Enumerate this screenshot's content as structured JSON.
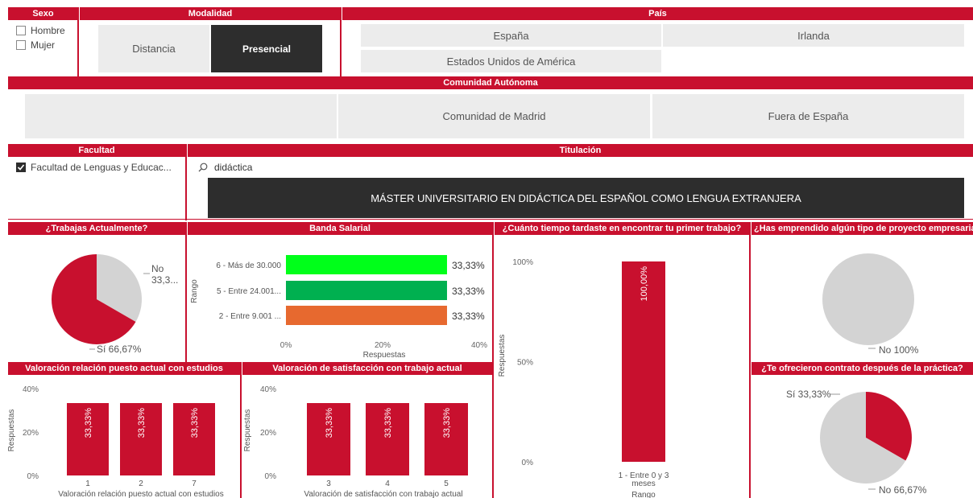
{
  "filters": {
    "sexo": {
      "header": "Sexo",
      "options": [
        "Hombre",
        "Mujer"
      ]
    },
    "modalidad": {
      "header": "Modalidad",
      "options": [
        "Distancia",
        "Presencial"
      ],
      "selected": "Presencial"
    },
    "pais": {
      "header": "País",
      "options": [
        "España",
        "Irlanda",
        "Estados Unidos de América"
      ]
    },
    "comunidad": {
      "header": "Comunidad Autónoma",
      "options": [
        "",
        "Comunidad de Madrid",
        "Fuera de España"
      ]
    },
    "facultad": {
      "header": "Facultad",
      "option": "Facultad de Lenguas y Educac..."
    },
    "titulacion": {
      "header": "Titulación",
      "search_value": "didáctica",
      "result": "MÁSTER UNIVERSITARIO EN DIDÁCTICA DEL ESPAÑOL COMO LENGUA EXTRANJERA"
    }
  },
  "colors": {
    "brand": "#c8102e",
    "grey": "#d3d3d3",
    "dark": "#2d2d2d",
    "green_bright": "#00ff1a",
    "green": "#00b050",
    "orange": "#e7692f"
  },
  "charts": {
    "trabajas": {
      "title": "¿Trabajas Actualmente?",
      "label_no": "No",
      "label_no_pct": "33,3...",
      "label_si": "Sí 66,67%"
    },
    "banda": {
      "title": "Banda Salarial",
      "ylabel": "Rango",
      "xlabel": "Respuestas"
    },
    "tiempo": {
      "title": "¿Cuánto tiempo tardaste en encontrar tu primer trabajo?",
      "ylabel": "Respuestas",
      "xlabel": "Rango"
    },
    "emprendido": {
      "title": "¿Has emprendido algún tipo de proyecto empresarial?",
      "label": "No 100%"
    },
    "relacion": {
      "title": "Valoración relación puesto actual con estudios",
      "ylabel": "Respuestas",
      "xlabel": "Valoración relación puesto actual con estudios"
    },
    "satisfaccion": {
      "title": "Valoración de satisfacción con trabajo actual",
      "ylabel": "Respuestas",
      "xlabel": "Valoración de satisfacción con trabajo actual"
    },
    "contrato": {
      "title": "¿Te ofrecieron contrato después de la práctica?",
      "label_si": "Sí 33,33%",
      "label_no": "No 66,67%"
    }
  },
  "chart_data": [
    {
      "type": "pie",
      "title": "¿Trabajas Actualmente?",
      "slices": [
        {
          "name": "No",
          "value": 33.33,
          "color": "#d3d3d3"
        },
        {
          "name": "Sí",
          "value": 66.67,
          "color": "#c8102e"
        }
      ]
    },
    {
      "type": "bar",
      "orientation": "horizontal",
      "title": "Banda Salarial",
      "xlabel": "Respuestas",
      "ylabel": "Rango",
      "categories": [
        "6 - Más de 30.000",
        "5 - Entre 24.001...",
        "2 - Entre 9.001 ..."
      ],
      "values": [
        33.33,
        33.33,
        33.33
      ],
      "value_labels": [
        "33,33%",
        "33,33%",
        "33,33%"
      ],
      "bar_colors": [
        "#00ff1a",
        "#00b050",
        "#e7692f"
      ],
      "xlim": [
        0,
        40
      ],
      "ticks": [
        "0%",
        "20%",
        "40%"
      ]
    },
    {
      "type": "bar",
      "title": "¿Cuánto tiempo tardaste en encontrar tu primer trabajo?",
      "xlabel": "Rango",
      "ylabel": "Respuestas",
      "categories": [
        "1 - Entre 0 y 3 meses"
      ],
      "values": [
        100
      ],
      "value_labels": [
        "100,00%"
      ],
      "ylim": [
        0,
        100
      ],
      "ticks": [
        "0%",
        "50%",
        "100%"
      ]
    },
    {
      "type": "pie",
      "title": "¿Has emprendido algún tipo de proyecto empresarial?",
      "slices": [
        {
          "name": "No",
          "value": 100,
          "color": "#d3d3d3"
        }
      ]
    },
    {
      "type": "bar",
      "title": "Valoración relación puesto actual con estudios",
      "xlabel": "Valoración relación puesto actual con estudios",
      "ylabel": "Respuestas",
      "categories": [
        "1",
        "2",
        "7"
      ],
      "values": [
        33.33,
        33.33,
        33.33
      ],
      "value_labels": [
        "33,33%",
        "33,33%",
        "33,33%"
      ],
      "ylim": [
        0,
        40
      ],
      "ticks": [
        "0%",
        "20%",
        "40%"
      ]
    },
    {
      "type": "bar",
      "title": "Valoración de satisfacción con trabajo actual",
      "xlabel": "Valoración de satisfacción con trabajo actual",
      "ylabel": "Respuestas",
      "categories": [
        "3",
        "4",
        "5"
      ],
      "values": [
        33.33,
        33.33,
        33.33
      ],
      "value_labels": [
        "33,33%",
        "33,33%",
        "33,33%"
      ],
      "ylim": [
        0,
        40
      ],
      "ticks": [
        "0%",
        "20%",
        "40%"
      ]
    },
    {
      "type": "pie",
      "title": "¿Te ofrecieron contrato después de la práctica?",
      "slices": [
        {
          "name": "Sí",
          "value": 33.33,
          "color": "#c8102e"
        },
        {
          "name": "No",
          "value": 66.67,
          "color": "#d3d3d3"
        }
      ]
    }
  ]
}
